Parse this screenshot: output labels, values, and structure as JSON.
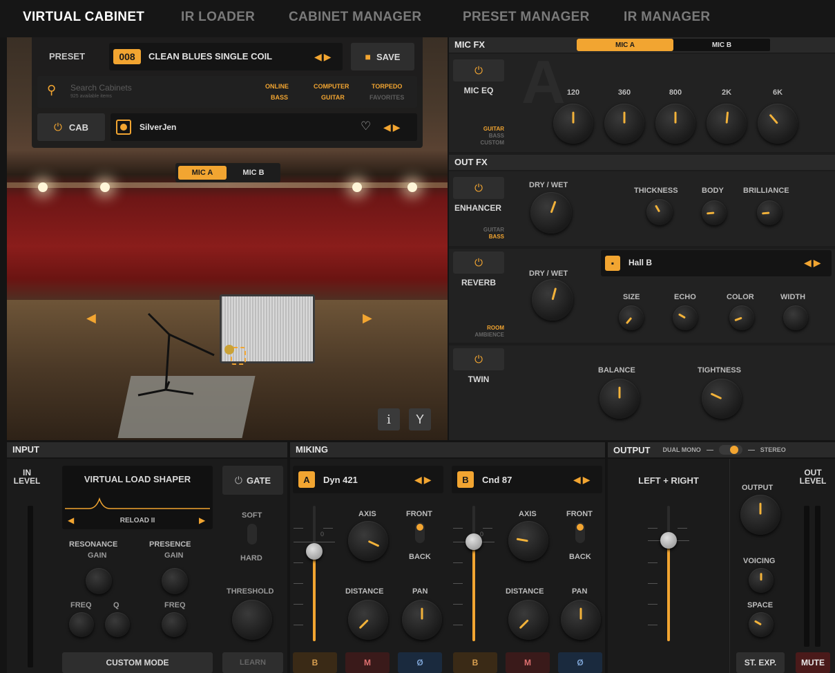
{
  "nav": {
    "tabs": [
      "VIRTUAL CABINET",
      "IR LOADER",
      "CABINET MANAGER",
      "PRESET MANAGER",
      "IR MANAGER"
    ]
  },
  "preset": {
    "label": "PRESET",
    "number": "008",
    "name": "CLEAN BLUES SINGLE COIL",
    "save_label": "SAVE"
  },
  "search": {
    "placeholder": "Search Cabinets",
    "count": "925 available items",
    "filters_top": [
      "ONLINE",
      "COMPUTER",
      "TORPEDO"
    ],
    "filters_bottom": [
      "BASS",
      "GUITAR",
      "FAVORITES"
    ]
  },
  "cab": {
    "label": "CAB",
    "name": "SilverJen"
  },
  "stage": {
    "mic_a": "MIC A",
    "mic_b": "MIC B",
    "info_icon": "i",
    "tuning_icon": "Y"
  },
  "micfx": {
    "header": "MIC FX",
    "tab_a": "MIC A",
    "tab_b": "MIC B",
    "eq_label": "MIC EQ",
    "watermark": "A",
    "modes": [
      "GUITAR",
      "BASS",
      "CUSTOM"
    ],
    "bands": [
      "120",
      "360",
      "800",
      "2K",
      "6K"
    ],
    "band_values": [
      0.5,
      0.5,
      0.5,
      0.52,
      0.35
    ]
  },
  "outfx": {
    "header": "OUT FX",
    "enhancer": {
      "label": "ENHANCER",
      "modes": [
        "GUITAR",
        "BASS"
      ],
      "drywet": "DRY / WET",
      "knobs": [
        "THICKNESS",
        "BODY",
        "BRILLIANCE"
      ],
      "values": [
        0.4,
        0.25,
        0.25
      ]
    },
    "reverb": {
      "label": "REVERB",
      "preset": "Hall B",
      "drywet": "DRY / WET",
      "modes": [
        "ROOM",
        "AMBIENCE"
      ],
      "knobs": [
        "SIZE",
        "ECHO",
        "COLOR",
        "WIDTH"
      ]
    },
    "twin": {
      "label": "TWIN",
      "knobs": [
        "BALANCE",
        "TIGHTNESS"
      ]
    }
  },
  "input": {
    "header": "INPUT",
    "in_level": "IN LEVEL",
    "vls_title": "VIRTUAL LOAD SHAPER",
    "vls_preset": "RELOAD II",
    "resonance": "RESONANCE",
    "presence": "PRESENCE",
    "gain": "GAIN",
    "freq": "FREQ",
    "q": "Q",
    "custom_mode": "CUSTOM MODE",
    "gate": "GATE",
    "soft": "SOFT",
    "hard": "HARD",
    "threshold": "THRESHOLD",
    "learn": "LEARN"
  },
  "miking": {
    "header": "MIKING",
    "mics": [
      {
        "letter": "A",
        "name": "Dyn 421"
      },
      {
        "letter": "B",
        "name": "Cnd 87"
      }
    ],
    "axis": "AXIS",
    "front": "FRONT",
    "back": "BACK",
    "distance": "DISTANCE",
    "pan": "PAN",
    "zero": "0",
    "buttons": [
      "B",
      "M",
      "Ø"
    ]
  },
  "output": {
    "header": "OUTPUT",
    "dual_mono": "DUAL MONO",
    "stereo": "STEREO",
    "left_right": "LEFT + RIGHT",
    "output_label": "OUTPUT",
    "out_level": "OUT LEVEL",
    "voicing": "VOICING",
    "space": "SPACE",
    "st_exp": "ST. EXP.",
    "mute": "MUTE"
  },
  "colors": {
    "accent": "#f2a531",
    "mute_red": "#7a1e1e"
  }
}
